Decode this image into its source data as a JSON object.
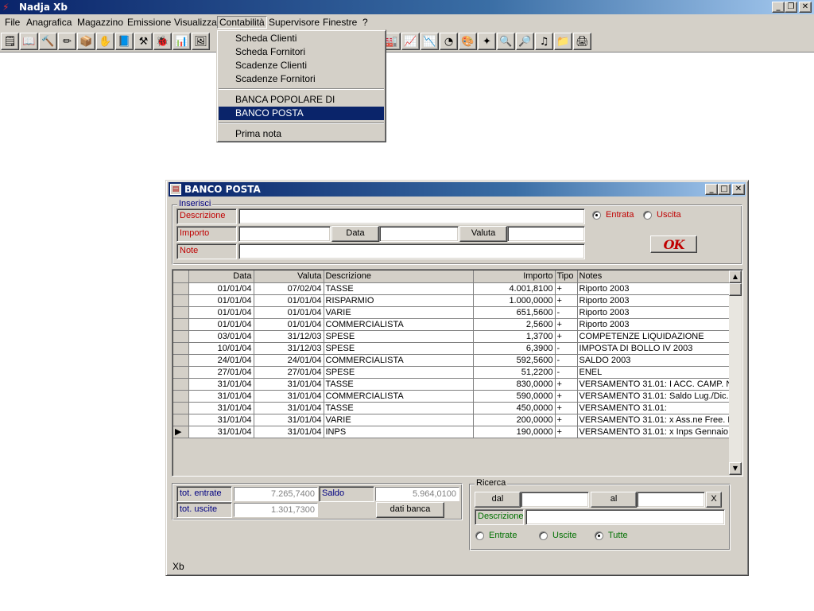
{
  "app": {
    "title": "Nadja Xb",
    "icon": "nadja-logo-icon"
  },
  "menubar": [
    "File",
    "Anagrafica",
    "Magazzino",
    "Emissione",
    "Visualizza",
    "Contabilità",
    "Supervisore",
    "Finestre",
    "?"
  ],
  "menubar_active": "Contabilità",
  "dropdown": {
    "items": [
      "Scheda Clienti",
      "Scheda Fornitori",
      "Scadenze Clienti",
      "Scadenze Fornitori"
    ],
    "banks": [
      "BANCA POPOLARE DI CROTONE",
      "BANCO POSTA"
    ],
    "selected": "BANCO POSTA",
    "last": "Prima nota"
  },
  "window": {
    "title": "BANCO POSTA",
    "inserisci": {
      "group_label": "Inserisci",
      "descrizione_label": "Descrizione",
      "importo_label": "Importo",
      "note_label": "Note",
      "data_button": "Data",
      "valuta_button": "Valuta",
      "entrata_label": "Entrata",
      "uscita_label": "Uscita",
      "tipo_selected": "Entrata",
      "ok_button": "OK",
      "descrizione_value": "",
      "importo_value": "",
      "data_value": "",
      "valuta_value": "",
      "note_value": ""
    },
    "grid": {
      "columns": [
        "Data",
        "Valuta",
        "Descrizione",
        "Importo",
        "Tipo",
        "Notes"
      ],
      "rows": [
        [
          "01/01/04",
          "07/02/04",
          "TASSE",
          "4.001,8100",
          "+",
          "Riporto 2003"
        ],
        [
          "01/01/04",
          "01/01/04",
          "RISPARMIO",
          "1.000,0000",
          "+",
          "Riporto 2003"
        ],
        [
          "01/01/04",
          "01/01/04",
          "VARIE",
          "651,5600",
          "-",
          "Riporto 2003"
        ],
        [
          "01/01/04",
          "01/01/04",
          "COMMERCIALISTA",
          "2,5600",
          "+",
          "Riporto 2003"
        ],
        [
          "03/01/04",
          "31/12/03",
          "SPESE",
          "1,3700",
          "+",
          "COMPETENZE LIQUIDAZIONE"
        ],
        [
          "10/01/04",
          "31/12/03",
          "SPESE",
          "6,3900",
          "-",
          "IMPOSTA DI BOLLO IV 2003"
        ],
        [
          "24/01/04",
          "24/01/04",
          "COMMERCIALISTA",
          "592,5600",
          "-",
          "SALDO 2003"
        ],
        [
          "27/01/04",
          "27/01/04",
          "SPESE",
          "51,2200",
          "-",
          "ENEL"
        ],
        [
          "31/01/04",
          "31/01/04",
          "TASSE",
          "830,0000",
          "+",
          "VERSAMENTO 31.01: I ACC. CAMP. N."
        ],
        [
          "31/01/04",
          "31/01/04",
          "COMMERCIALISTA",
          "590,0000",
          "+",
          "VERSAMENTO 31.01: Saldo Lug./Dic."
        ],
        [
          "31/01/04",
          "31/01/04",
          "TASSE",
          "450,0000",
          "+",
          "VERSAMENTO 31.01:"
        ],
        [
          "31/01/04",
          "31/01/04",
          "VARIE",
          "200,0000",
          "+",
          "VERSAMENTO 31.01: x Ass.ne Free. D"
        ],
        [
          "31/01/04",
          "31/01/04",
          "INPS",
          "190,0000",
          "+",
          "VERSAMENTO 31.01: x Inps Gennaio"
        ]
      ],
      "current_row": 12
    },
    "totali": {
      "tot_entrate_label": "tot. entrate",
      "tot_entrate": "7.265,7400",
      "tot_uscite_label": "tot. uscite",
      "tot_uscite": "1.301,7300",
      "saldo_label": "Saldo",
      "saldo": "5.964,0100",
      "dati_banca_button": "dati banca"
    },
    "ricerca": {
      "group_label": "Ricerca",
      "dal_button": "dal",
      "al_button": "al",
      "clear_button": "X",
      "descrizione_label": "Descrizione",
      "entrate_label": "Entrate",
      "uscite_label": "Uscite",
      "tutte_label": "Tutte",
      "selected": "Tutte"
    },
    "status": "Xb"
  }
}
